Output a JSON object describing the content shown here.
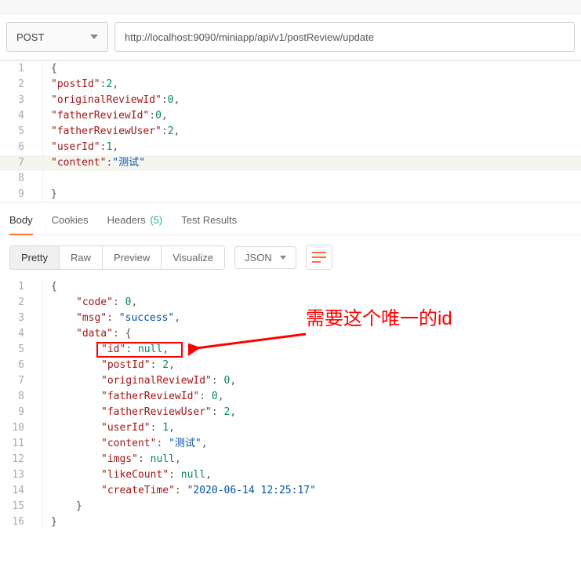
{
  "request": {
    "method": "POST",
    "url": "http://localhost:9090/miniapp/api/v1/postReview/update"
  },
  "request_body_lines": [
    [
      {
        "t": "punct",
        "v": "{"
      }
    ],
    [
      {
        "t": "key",
        "v": "\"postId\""
      },
      {
        "t": "punct",
        "v": ":"
      },
      {
        "t": "num",
        "v": "2"
      },
      {
        "t": "punct",
        "v": ","
      }
    ],
    [
      {
        "t": "key",
        "v": "\"originalReviewId\""
      },
      {
        "t": "punct",
        "v": ":"
      },
      {
        "t": "num",
        "v": "0"
      },
      {
        "t": "punct",
        "v": ","
      }
    ],
    [
      {
        "t": "key",
        "v": "\"fatherReviewId\""
      },
      {
        "t": "punct",
        "v": ":"
      },
      {
        "t": "num",
        "v": "0"
      },
      {
        "t": "punct",
        "v": ","
      }
    ],
    [
      {
        "t": "key",
        "v": "\"fatherReviewUser\""
      },
      {
        "t": "punct",
        "v": ":"
      },
      {
        "t": "num",
        "v": "2"
      },
      {
        "t": "punct",
        "v": ","
      }
    ],
    [
      {
        "t": "key",
        "v": "\"userId\""
      },
      {
        "t": "punct",
        "v": ":"
      },
      {
        "t": "num",
        "v": "1"
      },
      {
        "t": "punct",
        "v": ","
      }
    ],
    [
      {
        "t": "key",
        "v": "\"content\""
      },
      {
        "t": "punct",
        "v": ":"
      },
      {
        "t": "str",
        "v": "\"测试\""
      }
    ],
    [],
    [
      {
        "t": "punct",
        "v": "}"
      }
    ]
  ],
  "response_tabs": {
    "body": "Body",
    "cookies": "Cookies",
    "headers": "Headers",
    "headers_count": "(5)",
    "test_results": "Test Results"
  },
  "view_modes": {
    "pretty": "Pretty",
    "raw": "Raw",
    "preview": "Preview",
    "visualize": "Visualize",
    "format": "JSON"
  },
  "response_body_lines": [
    {
      "indent": 0,
      "tokens": [
        {
          "t": "punct",
          "v": "{"
        }
      ]
    },
    {
      "indent": 1,
      "tokens": [
        {
          "t": "key",
          "v": "\"code\""
        },
        {
          "t": "punct",
          "v": ": "
        },
        {
          "t": "num",
          "v": "0"
        },
        {
          "t": "punct",
          "v": ","
        }
      ]
    },
    {
      "indent": 1,
      "tokens": [
        {
          "t": "key",
          "v": "\"msg\""
        },
        {
          "t": "punct",
          "v": ": "
        },
        {
          "t": "str",
          "v": "\"success\""
        },
        {
          "t": "punct",
          "v": ","
        }
      ]
    },
    {
      "indent": 1,
      "tokens": [
        {
          "t": "key",
          "v": "\"data\""
        },
        {
          "t": "punct",
          "v": ": {"
        }
      ]
    },
    {
      "indent": 2,
      "tokens": [
        {
          "t": "key",
          "v": "\"id\""
        },
        {
          "t": "punct",
          "v": ": "
        },
        {
          "t": "num",
          "v": "null"
        },
        {
          "t": "punct",
          "v": ","
        }
      ]
    },
    {
      "indent": 2,
      "tokens": [
        {
          "t": "key",
          "v": "\"postId\""
        },
        {
          "t": "punct",
          "v": ": "
        },
        {
          "t": "num",
          "v": "2"
        },
        {
          "t": "punct",
          "v": ","
        }
      ]
    },
    {
      "indent": 2,
      "tokens": [
        {
          "t": "key",
          "v": "\"originalReviewId\""
        },
        {
          "t": "punct",
          "v": ": "
        },
        {
          "t": "num",
          "v": "0"
        },
        {
          "t": "punct",
          "v": ","
        }
      ]
    },
    {
      "indent": 2,
      "tokens": [
        {
          "t": "key",
          "v": "\"fatherReviewId\""
        },
        {
          "t": "punct",
          "v": ": "
        },
        {
          "t": "num",
          "v": "0"
        },
        {
          "t": "punct",
          "v": ","
        }
      ]
    },
    {
      "indent": 2,
      "tokens": [
        {
          "t": "key",
          "v": "\"fatherReviewUser\""
        },
        {
          "t": "punct",
          "v": ": "
        },
        {
          "t": "num",
          "v": "2"
        },
        {
          "t": "punct",
          "v": ","
        }
      ]
    },
    {
      "indent": 2,
      "tokens": [
        {
          "t": "key",
          "v": "\"userId\""
        },
        {
          "t": "punct",
          "v": ": "
        },
        {
          "t": "num",
          "v": "1"
        },
        {
          "t": "punct",
          "v": ","
        }
      ]
    },
    {
      "indent": 2,
      "tokens": [
        {
          "t": "key",
          "v": "\"content\""
        },
        {
          "t": "punct",
          "v": ": "
        },
        {
          "t": "str",
          "v": "\"测试\""
        },
        {
          "t": "punct",
          "v": ","
        }
      ]
    },
    {
      "indent": 2,
      "tokens": [
        {
          "t": "key",
          "v": "\"imgs\""
        },
        {
          "t": "punct",
          "v": ": "
        },
        {
          "t": "num",
          "v": "null"
        },
        {
          "t": "punct",
          "v": ","
        }
      ]
    },
    {
      "indent": 2,
      "tokens": [
        {
          "t": "key",
          "v": "\"likeCount\""
        },
        {
          "t": "punct",
          "v": ": "
        },
        {
          "t": "num",
          "v": "null"
        },
        {
          "t": "punct",
          "v": ","
        }
      ]
    },
    {
      "indent": 2,
      "tokens": [
        {
          "t": "key",
          "v": "\"createTime\""
        },
        {
          "t": "punct",
          "v": ": "
        },
        {
          "t": "str",
          "v": "\"2020-06-14 12:25:17\""
        }
      ]
    },
    {
      "indent": 1,
      "tokens": [
        {
          "t": "punct",
          "v": "}"
        }
      ]
    },
    {
      "indent": 0,
      "tokens": [
        {
          "t": "punct",
          "v": "}"
        }
      ]
    }
  ],
  "annotation_text": "需要这个唯一的id"
}
